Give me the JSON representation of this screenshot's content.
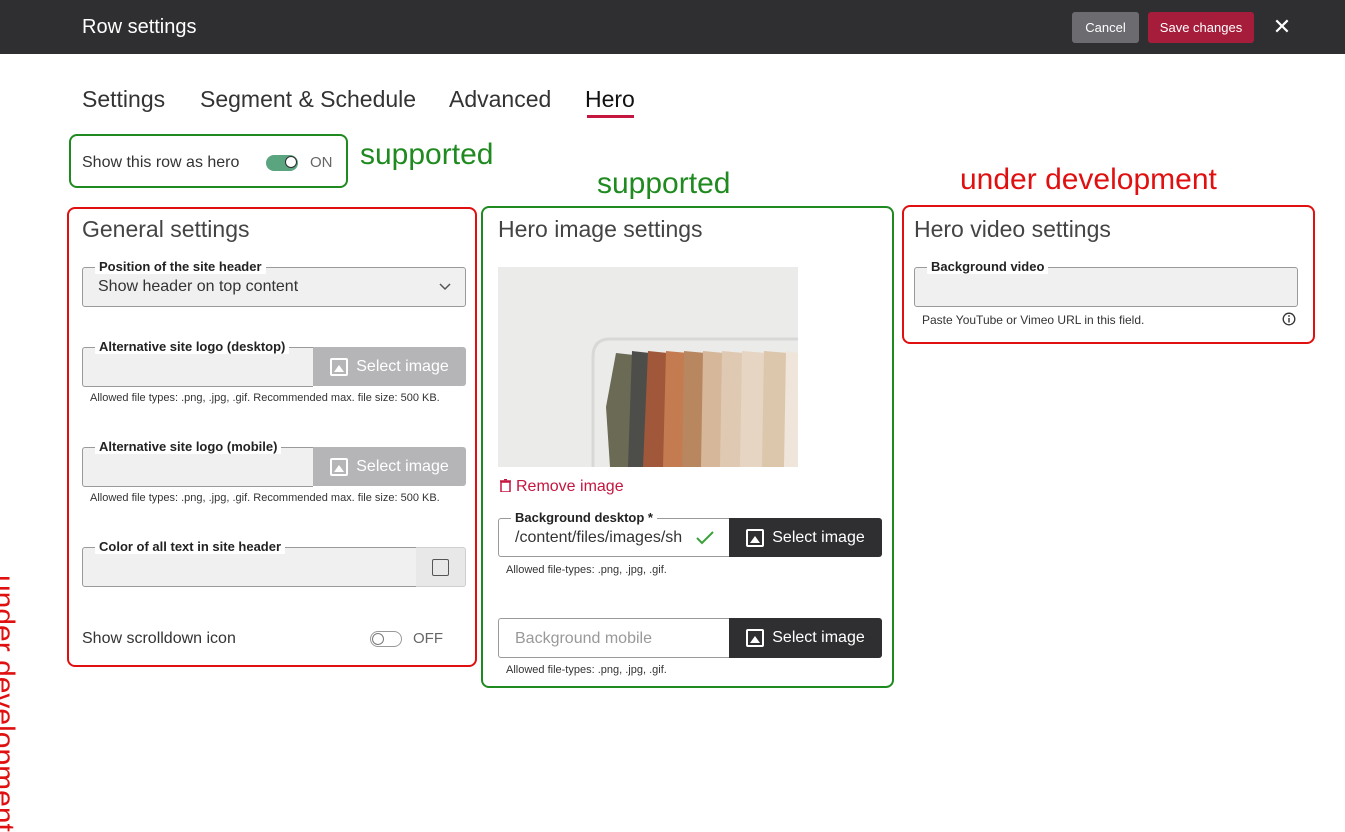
{
  "header": {
    "title": "Row settings",
    "cancel": "Cancel",
    "save": "Save changes",
    "close": "✕"
  },
  "tabs": [
    "Settings",
    "Segment & Schedule",
    "Advanced",
    "Hero"
  ],
  "active_tab": "Hero",
  "hero_toggle": {
    "label": "Show this row as hero",
    "state": "ON"
  },
  "annotations": {
    "supported_1": "supported",
    "supported_2": "supported",
    "under_dev_right": "under development",
    "under_dev_left": "under development"
  },
  "general": {
    "title": "General settings",
    "position": {
      "label": "Position of the site header",
      "value": "Show header on top content"
    },
    "logo_desktop": {
      "label": "Alternative site logo (desktop)",
      "button": "Select image",
      "help": "Allowed file types: .png, .jpg, .gif. Recommended max. file size: 500 KB."
    },
    "logo_mobile": {
      "label": "Alternative site logo (mobile)",
      "button": "Select image",
      "help": "Allowed file types: .png, .jpg, .gif. Recommended max. file size: 500 KB."
    },
    "color": {
      "label": "Color of all text in site header"
    },
    "scrolldown": {
      "label": "Show scrolldown icon",
      "state": "OFF"
    }
  },
  "hero_image": {
    "title": "Hero image settings",
    "remove": "Remove image",
    "desktop": {
      "label": "Background desktop *",
      "value": "/content/files/images/sh",
      "button": "Select image",
      "help": "Allowed file-types: .png, .jpg, .gif."
    },
    "mobile": {
      "placeholder": "Background mobile",
      "button": "Select image",
      "help": "Allowed file-types: .png, .jpg, .gif."
    }
  },
  "hero_video": {
    "title": "Hero video settings",
    "label": "Background video",
    "help": "Paste YouTube or Vimeo URL in this field."
  },
  "colors": {
    "accent": "#c4163f",
    "topbar": "#2f2f32",
    "supported": "#1f8a1f",
    "dev": "#e01010"
  }
}
